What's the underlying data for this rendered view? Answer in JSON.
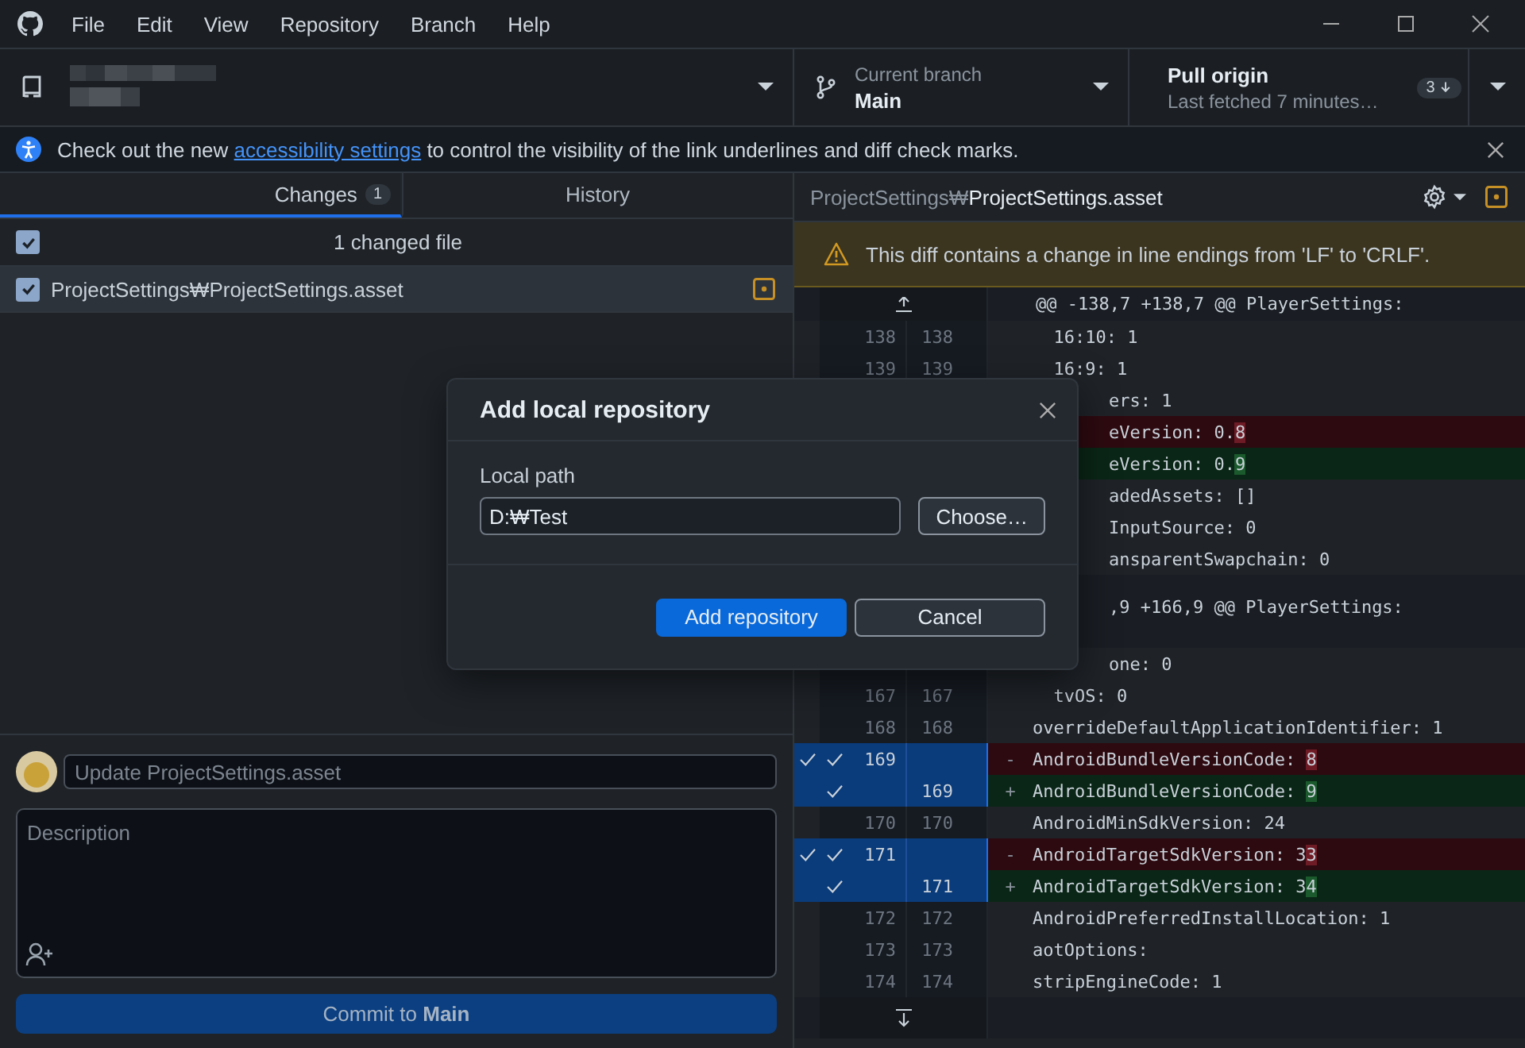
{
  "menu": [
    "File",
    "Edit",
    "View",
    "Repository",
    "Branch",
    "Help"
  ],
  "toolbar": {
    "branch": {
      "caption": "Current branch",
      "value": "Main"
    },
    "pull": {
      "title": "Pull origin",
      "subtitle": "Last fetched 7 minutes…",
      "badge": "3"
    }
  },
  "banner": {
    "before": "Check out the new",
    "link": "accessibility settings",
    "after": "to control the visibility of the link underlines and diff check marks."
  },
  "tabs": [
    {
      "label": "Changes",
      "count": "1",
      "selected": true
    },
    {
      "label": "History",
      "selected": false
    }
  ],
  "changes": {
    "header": "1 changed file",
    "all_checked": true,
    "files": [
      {
        "path": "ProjectSettings₩ProjectSettings.asset",
        "checked": true,
        "selected": true
      }
    ]
  },
  "commit": {
    "summary_placeholder": "Update ProjectSettings.asset",
    "description_placeholder": "Description",
    "button": "Commit to **Main**"
  },
  "diff": {
    "dir": "ProjectSettings₩",
    "file": "ProjectSettings.asset",
    "warning": "This diff contains a change in line endings from 'LF' to 'CRLF'.",
    "rows": [
      {
        "kind": "hunk",
        "text": "@@ -138,7 +138,7 @@ PlayerSettings:"
      },
      {
        "kind": "context",
        "old": "138",
        "new": "138",
        "text": "  16:10: 1",
        "selected": false
      },
      {
        "kind": "context",
        "old": "139",
        "new": "139",
        "text": "  16:9: 1",
        "selected": false
      },
      {
        "kind": "context",
        "text": "ers: 1",
        "behind_dialog": true
      },
      {
        "kind": "deleted",
        "text": "eVersion: 0.",
        "highlight": "8",
        "behind_dialog": true
      },
      {
        "kind": "added",
        "text": "eVersion: 0.",
        "highlight": "9",
        "behind_dialog": true
      },
      {
        "kind": "context",
        "text": "adedAssets: []",
        "behind_dialog": true
      },
      {
        "kind": "context",
        "text": "InputSource: 0",
        "behind_dialog": true
      },
      {
        "kind": "context",
        "text": "ansparentSwapchain: 0",
        "behind_dialog": true
      },
      {
        "kind": "hunk",
        "text": ",9 +166,9 @@ PlayerSettings:",
        "behind_dialog": true
      },
      {
        "kind": "context",
        "text": "one: 0",
        "behind_dialog": true
      },
      {
        "kind": "context",
        "old": "167",
        "new": "167",
        "text": "  tvOS: 0",
        "selected": false
      },
      {
        "kind": "context",
        "old": "168",
        "new": "168",
        "text": "overrideDefaultApplicationIdentifier: 1",
        "selected": false
      },
      {
        "kind": "deleted",
        "old": "169",
        "sign": "-",
        "text": "AndroidBundleVersionCode: ",
        "highlight": "8",
        "selected": true
      },
      {
        "kind": "added",
        "new": "169",
        "sign": "+",
        "text": "AndroidBundleVersionCode: ",
        "highlight": "9",
        "selected": true
      },
      {
        "kind": "context",
        "old": "170",
        "new": "170",
        "text": "AndroidMinSdkVersion: 24",
        "selected": false
      },
      {
        "kind": "deleted",
        "old": "171",
        "sign": "-",
        "text": "AndroidTargetSdkVersion: 3",
        "highlight": "3",
        "selected": true
      },
      {
        "kind": "added",
        "new": "171",
        "sign": "+",
        "text": "AndroidTargetSdkVersion: 3",
        "highlight": "4",
        "selected": true
      },
      {
        "kind": "context",
        "old": "172",
        "new": "172",
        "text": "AndroidPreferredInstallLocation: 1",
        "selected": false
      },
      {
        "kind": "context",
        "old": "173",
        "new": "173",
        "text": "aotOptions:",
        "selected": false
      },
      {
        "kind": "context",
        "old": "174",
        "new": "174",
        "text": "stripEngineCode: 1",
        "selected": false
      },
      {
        "kind": "expand"
      }
    ]
  },
  "dialog": {
    "title": "Add local repository",
    "field_label": "Local path",
    "field_value": "D:₩Test",
    "choose": "Choose…",
    "primary": "Add repository",
    "cancel": "Cancel"
  }
}
